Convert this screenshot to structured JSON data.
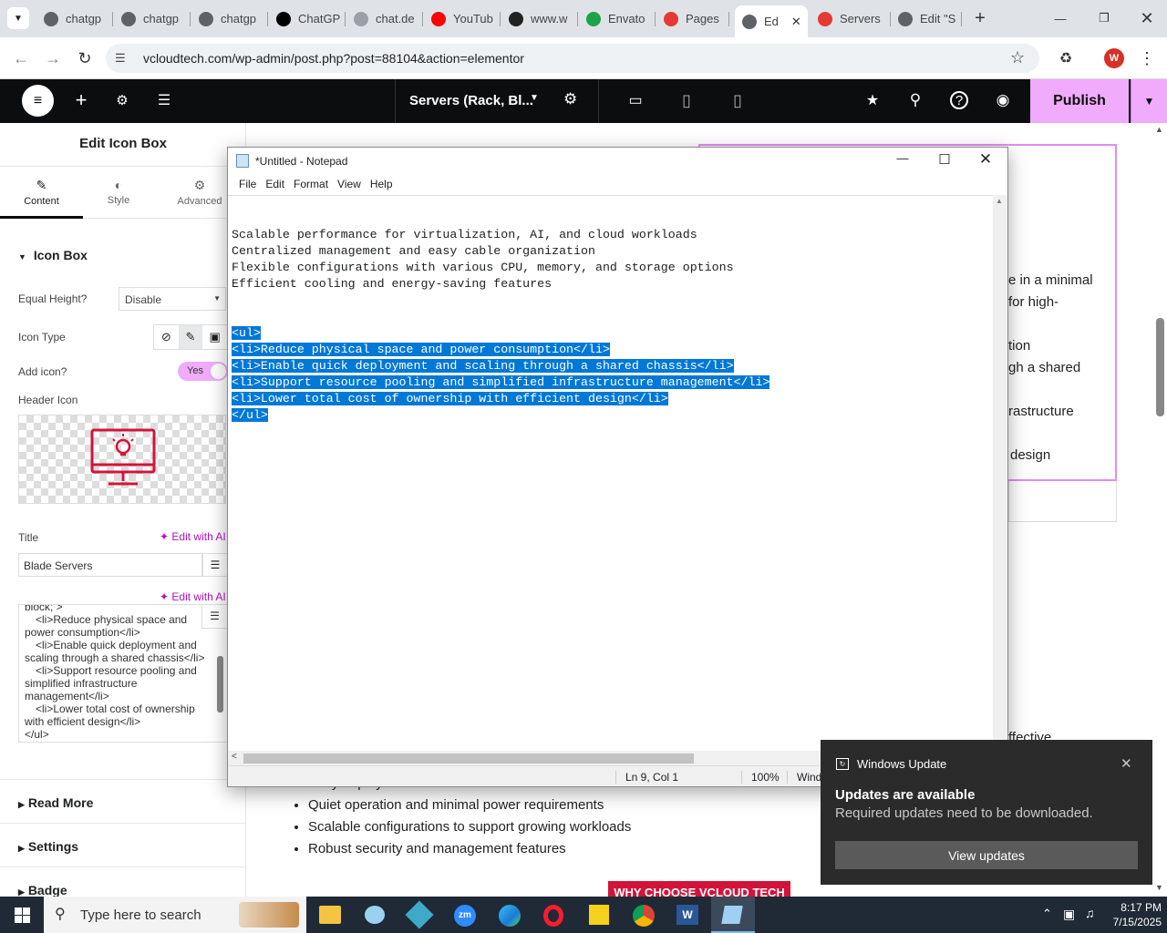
{
  "browser": {
    "tabs": [
      {
        "label": "chatgp",
        "color": "#5f6368"
      },
      {
        "label": "chatgp",
        "color": "#5f6368"
      },
      {
        "label": "chatgp",
        "color": "#5f6368"
      },
      {
        "label": "ChatGP",
        "color": "#000000"
      },
      {
        "label": "chat.de",
        "color": "#9aa0a6"
      },
      {
        "label": "YouTub",
        "color": "#ff0000"
      },
      {
        "label": "www.w",
        "color": "#222222"
      },
      {
        "label": "Envato",
        "color": "#1aa34a"
      },
      {
        "label": "Pages",
        "color": "#e53935"
      },
      {
        "label": "Ed",
        "color": "#5f6368"
      },
      {
        "label": "Servers",
        "color": "#e53935"
      },
      {
        "label": "Edit \"S",
        "color": "#5f6368"
      }
    ],
    "url": "vcloudtech.com/wp-admin/post.php?post=88104&action=elementor",
    "profile_initial": "W"
  },
  "elementor": {
    "page_title": "Servers (Rack, Bl...",
    "publish_label": "Publish",
    "panel_title": "Edit Icon Box",
    "panel_tabs": [
      "Content",
      "Style",
      "Advanced"
    ],
    "section_title": "Icon Box",
    "equal_height_label": "Equal Height?",
    "equal_height_value": "Disable",
    "icon_type_label": "Icon Type",
    "add_icon_label": "Add icon?",
    "add_icon_value": "Yes",
    "header_icon_label": "Header Icon",
    "title_label": "Title",
    "edit_with_ai": "Edit with AI",
    "title_value": "Blade Servers",
    "editor_lines": [
      "block; >",
      "<li>Reduce physical space and",
      "power consumption</li>",
      "<li>Enable quick deployment and",
      "scaling through a shared chassis</li>",
      "<li>Support resource pooling and",
      "simplified infrastructure",
      "management</li>",
      "<li>Lower total cost of ownership",
      "with efficient design</li>",
      "</ul>"
    ],
    "sections": [
      "Read More",
      "Settings",
      "Badge"
    ]
  },
  "canvas": {
    "right_fragments": [
      "e in a minimal",
      "for high-",
      "tion",
      "gh a shared",
      "rastructure",
      "design",
      "ffective"
    ],
    "bullets": [
      "Easy deployment without the need for racks or dedicated infrastructure",
      "Quiet operation and minimal power requirements",
      "Scalable configurations to support growing workloads",
      "Robust security and management features"
    ],
    "banner": "WHY CHOOSE VCLOUD TECH"
  },
  "notepad": {
    "title": "*Untitled - Notepad",
    "menu": [
      "File",
      "Edit",
      "Format",
      "View",
      "Help"
    ],
    "lines": [
      "Scalable performance for virtualization, AI, and cloud workloads",
      "Centralized management and easy cable organization",
      "Flexible configurations with various CPU, memory, and storage options",
      "Efficient cooling and energy-saving features"
    ],
    "selected_lines": [
      "<ul>",
      "<li>Reduce physical space and power consumption</li>",
      "<li>Enable quick deployment and scaling through a shared chassis</li>",
      "<li>Support resource pooling and simplified infrastructure management</li>",
      "<li>Lower total cost of ownership with efficient design</li>",
      "</ul>"
    ],
    "status_position": "Ln 9, Col 1",
    "status_zoom": "100%",
    "status_encoding": "Wind"
  },
  "toast": {
    "app": "Windows Update",
    "title": "Updates are available",
    "body": "Required updates need to be downloaded.",
    "button": "View updates"
  },
  "taskbar": {
    "search_placeholder": "Type here to search",
    "time": "8:17 PM",
    "date": "7/15/2025"
  },
  "colors": {
    "elementor_dark": "#0c0d0e",
    "publish_bg": "#f0abfc",
    "accent_pink": "#d004d4",
    "selection": "#0078d7",
    "icon_red": "#d2143a"
  }
}
